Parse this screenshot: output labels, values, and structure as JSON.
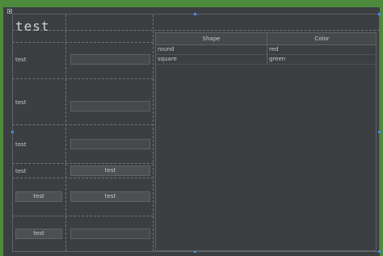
{
  "form": {
    "title": "test",
    "rows": [
      {
        "label": "test",
        "field_value": ""
      },
      {
        "label": "test",
        "field_value": ""
      },
      {
        "label": "test",
        "field_value": ""
      },
      {
        "label": "test",
        "button": "test"
      },
      {
        "left_button": "test",
        "right_button": "test"
      },
      {
        "left_button": "test",
        "field_value": ""
      }
    ]
  },
  "table": {
    "columns": [
      "Shape",
      "Color"
    ],
    "rows": [
      [
        "round",
        "red"
      ],
      [
        "square",
        "green"
      ]
    ]
  },
  "colors": {
    "background": "#3c3f41",
    "frame": "#4d8a3c",
    "selection_handle": "#4a88ff"
  }
}
